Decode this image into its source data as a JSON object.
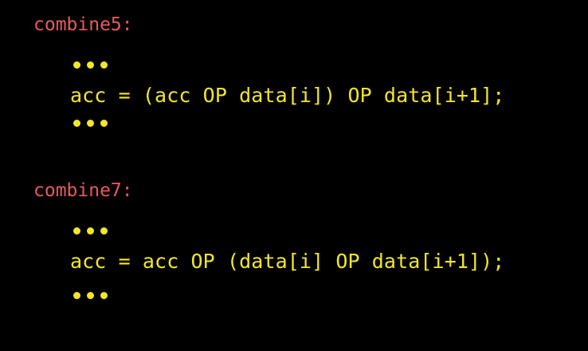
{
  "blocks": [
    {
      "label": "combine5:",
      "code": "acc = (acc OP data[i]) OP data[i+1];"
    },
    {
      "label": "combine7:",
      "code": "acc = acc OP (data[i] OP data[i+1]);"
    }
  ],
  "colors": {
    "background": "#000000",
    "label": "#e8595c",
    "code": "#f2e62a"
  }
}
